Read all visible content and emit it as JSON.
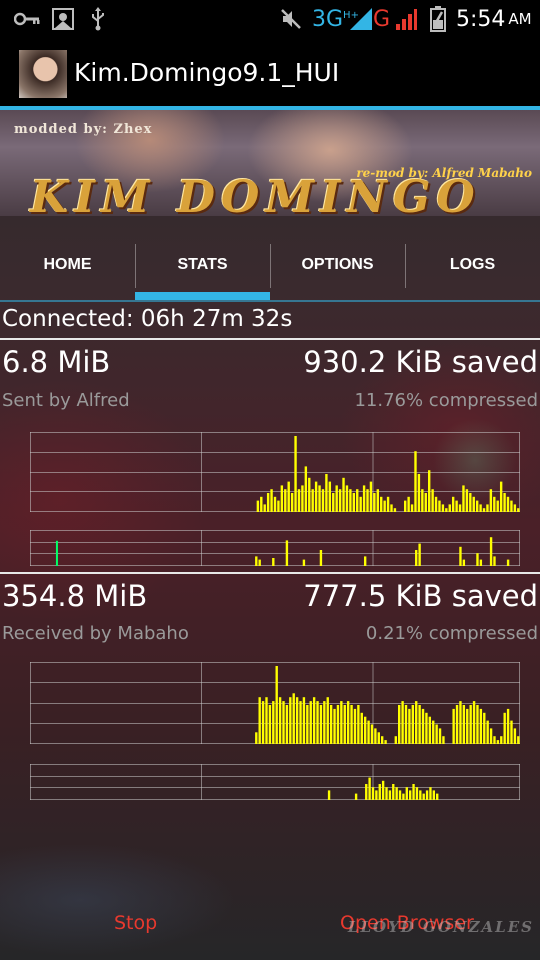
{
  "status_bar": {
    "network": "3G",
    "network_sup": "H+",
    "carrier": "G",
    "time": "5:54",
    "ampm": "AM",
    "icons": [
      "key-icon",
      "gallery-icon",
      "usb-icon",
      "mute-icon",
      "signal-icon",
      "battery-icon"
    ]
  },
  "app": {
    "title": "Kim.Domingo9.1_HUI"
  },
  "banner": {
    "credit_top": "modded by: Zhex",
    "credit_remod": "re-mod by: Alfred Mabaho",
    "title": "KIM DOMINGO"
  },
  "tabs": [
    {
      "label": "HOME",
      "selected": false
    },
    {
      "label": "STATS",
      "selected": true
    },
    {
      "label": "OPTIONS",
      "selected": false
    },
    {
      "label": "LOGS",
      "selected": false
    }
  ],
  "stats": {
    "connected": "Connected: 06h 27m 32s",
    "sent": {
      "amount": "6.8 MiB",
      "saved": "930.2 KiB saved",
      "label": "Sent by Alfred",
      "compressed": "11.76% compressed"
    },
    "received": {
      "amount": "354.8 MiB",
      "saved": "777.5 KiB saved",
      "label": "Received by Mabaho",
      "compressed": "0.21% compressed"
    }
  },
  "actions": {
    "stop": "Stop",
    "open_browser": "Open Browser"
  },
  "watermark": "LLOYD GONZALES",
  "colors": {
    "accent": "#33b5e5",
    "graph": "#ffff00",
    "graph_green": "#00ff66",
    "button_text": "#e8392e"
  },
  "graphs": {
    "sent_main": [
      0,
      0,
      0,
      0,
      0,
      0,
      0,
      0,
      0,
      0,
      0,
      0,
      0,
      0,
      0,
      0,
      0,
      0,
      0,
      0,
      0,
      0,
      0,
      0,
      0,
      0,
      0,
      0,
      0,
      0,
      0,
      0,
      0,
      0,
      0,
      0,
      0,
      0,
      0,
      0,
      0,
      0,
      0,
      0,
      0,
      0,
      0,
      0,
      0,
      0,
      0,
      0,
      0,
      0,
      0,
      0,
      0,
      0,
      0,
      0,
      0,
      0,
      0,
      0,
      0,
      0,
      0.15,
      0.2,
      0.1,
      0.25,
      0.3,
      0.2,
      0.15,
      0.35,
      0.3,
      0.4,
      0.25,
      1.0,
      0.3,
      0.35,
      0.6,
      0.45,
      0.3,
      0.4,
      0.35,
      0.3,
      0.5,
      0.4,
      0.25,
      0.35,
      0.3,
      0.45,
      0.35,
      0.3,
      0.25,
      0.3,
      0.2,
      0.35,
      0.3,
      0.4,
      0.25,
      0.3,
      0.2,
      0.15,
      0.2,
      0.1,
      0.05,
      0,
      0,
      0.15,
      0.2,
      0.1,
      0.8,
      0.5,
      0.3,
      0.25,
      0.55,
      0.3,
      0.2,
      0.15,
      0.1,
      0.05,
      0.1,
      0.2,
      0.15,
      0.1,
      0.35,
      0.3,
      0.25,
      0.2,
      0.15,
      0.1,
      0.05,
      0.1,
      0.3,
      0.2,
      0.15,
      0.4,
      0.25,
      0.2,
      0.15,
      0.1,
      0.05
    ],
    "sent_small": [
      0,
      0,
      0,
      0,
      0,
      0,
      0,
      0,
      0,
      0,
      0,
      0,
      0,
      0,
      0,
      0,
      0,
      0,
      0,
      0,
      0,
      0,
      0,
      0,
      0,
      0,
      0,
      0,
      0,
      0,
      0,
      0,
      0,
      0,
      0,
      0,
      0,
      0,
      0,
      0,
      0,
      0,
      0,
      0,
      0,
      0,
      0,
      0,
      0,
      0,
      0,
      0,
      0,
      0,
      0,
      0,
      0,
      0,
      0,
      0,
      0,
      0,
      0,
      0,
      0,
      0,
      0.3,
      0.2,
      0,
      0,
      0,
      0.25,
      0,
      0,
      0,
      0.8,
      0,
      0,
      0,
      0,
      0.2,
      0,
      0,
      0,
      0,
      0.5,
      0,
      0,
      0,
      0,
      0,
      0,
      0,
      0,
      0,
      0,
      0,
      0,
      0.3,
      0,
      0,
      0,
      0,
      0,
      0,
      0,
      0,
      0,
      0,
      0,
      0,
      0,
      0,
      0.5,
      0.7,
      0,
      0,
      0,
      0,
      0,
      0,
      0,
      0,
      0,
      0,
      0,
      0.6,
      0.2,
      0,
      0,
      0,
      0.4,
      0.2,
      0,
      0,
      0.9,
      0.3,
      0,
      0,
      0,
      0.2,
      0,
      0,
      0
    ],
    "recv_main": [
      0,
      0,
      0,
      0,
      0,
      0,
      0,
      0,
      0,
      0,
      0,
      0,
      0,
      0,
      0,
      0,
      0,
      0,
      0,
      0,
      0,
      0,
      0,
      0,
      0,
      0,
      0,
      0,
      0,
      0,
      0,
      0,
      0,
      0,
      0,
      0,
      0,
      0,
      0,
      0,
      0,
      0,
      0,
      0,
      0,
      0,
      0,
      0,
      0,
      0,
      0,
      0,
      0,
      0,
      0,
      0,
      0,
      0,
      0,
      0,
      0,
      0,
      0,
      0,
      0,
      0,
      0.15,
      0.6,
      0.55,
      0.6,
      0.5,
      0.55,
      1.0,
      0.6,
      0.55,
      0.5,
      0.6,
      0.65,
      0.6,
      0.55,
      0.6,
      0.5,
      0.55,
      0.6,
      0.55,
      0.5,
      0.55,
      0.6,
      0.5,
      0.45,
      0.5,
      0.55,
      0.5,
      0.55,
      0.5,
      0.45,
      0.5,
      0.4,
      0.35,
      0.3,
      0.25,
      0.2,
      0.15,
      0.1,
      0.05,
      0,
      0,
      0.1,
      0.5,
      0.55,
      0.5,
      0.45,
      0.5,
      0.55,
      0.5,
      0.45,
      0.4,
      0.35,
      0.3,
      0.25,
      0.2,
      0.1,
      0,
      0,
      0.45,
      0.5,
      0.55,
      0.5,
      0.45,
      0.5,
      0.55,
      0.5,
      0.45,
      0.4,
      0.3,
      0.2,
      0.1,
      0.05,
      0.1,
      0.4,
      0.45,
      0.3,
      0.2,
      0.1
    ],
    "recv_small": [
      0,
      0,
      0,
      0,
      0,
      0,
      0,
      0,
      0,
      0,
      0,
      0,
      0,
      0,
      0,
      0,
      0,
      0,
      0,
      0,
      0,
      0,
      0,
      0,
      0,
      0,
      0,
      0,
      0,
      0,
      0,
      0,
      0,
      0,
      0,
      0,
      0,
      0,
      0,
      0,
      0,
      0,
      0,
      0,
      0,
      0,
      0,
      0,
      0,
      0,
      0,
      0,
      0,
      0,
      0,
      0,
      0,
      0,
      0,
      0,
      0,
      0,
      0,
      0,
      0,
      0,
      0,
      0,
      0,
      0,
      0,
      0,
      0,
      0,
      0,
      0,
      0,
      0,
      0,
      0,
      0,
      0,
      0,
      0,
      0,
      0,
      0,
      0,
      0.3,
      0,
      0,
      0,
      0,
      0,
      0,
      0,
      0.2,
      0,
      0,
      0.5,
      0.7,
      0.4,
      0.3,
      0.5,
      0.6,
      0.4,
      0.3,
      0.5,
      0.4,
      0.3,
      0.2,
      0.4,
      0.3,
      0.5,
      0.4,
      0.3,
      0.2,
      0.3,
      0.4,
      0.3,
      0.2,
      0,
      0,
      0,
      0,
      0,
      0,
      0,
      0,
      0,
      0,
      0,
      0,
      0,
      0,
      0,
      0,
      0,
      0,
      0,
      0,
      0,
      0,
      0,
      0
    ]
  }
}
